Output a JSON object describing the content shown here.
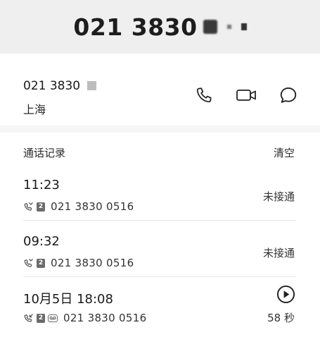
{
  "header": {
    "title": "021 3830"
  },
  "contact": {
    "number": "021 3830",
    "location": "上海",
    "actions": [
      {
        "name": "call",
        "icon": "phone-icon"
      },
      {
        "name": "video",
        "icon": "video-camera-icon"
      },
      {
        "name": "message",
        "icon": "chat-bubble-icon"
      }
    ]
  },
  "call_log": {
    "title": "通话记录",
    "clear_label": "清空",
    "records": [
      {
        "time": "11:23",
        "sim": "2",
        "number": "021 3830 0516",
        "status": "未接通"
      },
      {
        "time": "09:32",
        "sim": "2",
        "number": "021 3830 0516",
        "status": "未接通"
      },
      {
        "time": "10月5日 18:08",
        "sim": "2",
        "number": "021 3830 0516",
        "duration": "58 秒"
      }
    ]
  }
}
